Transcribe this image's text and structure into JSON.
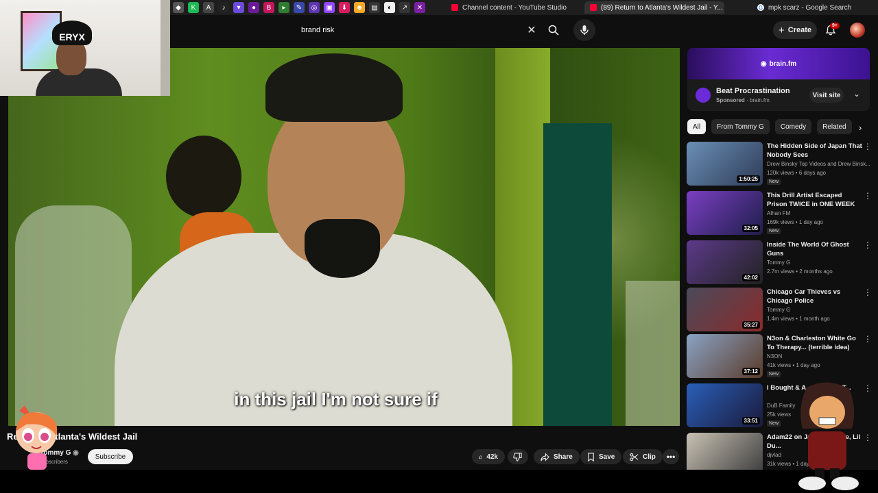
{
  "browser": {
    "tabs": [
      {
        "title": "Channel content - YouTube Studio",
        "active": false
      },
      {
        "title": "(89) Return to Atlanta's Wildest Jail - Y...",
        "active": true
      },
      {
        "title": "mpk scarz - Google Search",
        "active": false
      }
    ]
  },
  "header": {
    "search_value": "brand risk",
    "create_label": "Create",
    "notifications": "9+"
  },
  "video": {
    "caption": "in this jail I'm not sure if",
    "title": "Return to Atlanta's Wildest Jail",
    "title_visible": "Ret...nta's Wildest Jail",
    "channel": "Tommy G",
    "channel_visible": "my G",
    "subs_visible": "subscribers",
    "subscribe_label": "Subscribe",
    "likes": "42k",
    "share_label": "Share",
    "save_label": "Save",
    "clip_label": "Clip"
  },
  "ad": {
    "banner_text": "brain.fm",
    "title": "Beat Procrastination",
    "sponsored": "Sponsored",
    "domain": "brain.fm",
    "visit_label": "Visit site"
  },
  "chips": [
    "All",
    "From Tommy G",
    "Comedy",
    "Related"
  ],
  "recommendations": [
    {
      "title": "The Hidden Side of Japan That Nobody Sees",
      "channel": "Drew Binsky Top Videos and Drew Binsk...",
      "stats": "120k views • 6 days ago",
      "badge": "New",
      "duration": "1:50:25",
      "colors": [
        "#6a8fb5",
        "#2f3b58"
      ]
    },
    {
      "title": "This Drill Artist Escaped Prison TWICE in ONE WEEK",
      "channel": "Alhan FM",
      "stats": "169k views • 1 day ago",
      "badge": "New",
      "duration": "32:05",
      "colors": [
        "#7a3fc2",
        "#1e1e4a"
      ]
    },
    {
      "title": "Inside The World Of Ghost Guns",
      "channel": "Tommy G",
      "stats": "2.7m views • 2 months ago",
      "badge": "",
      "duration": "42:02",
      "colors": [
        "#5c3a8a",
        "#222"
      ]
    },
    {
      "title": "Chicago Car Thieves vs Chicago Police",
      "channel": "Tommy G",
      "stats": "1.4m views • 1 month ago",
      "badge": "",
      "duration": "35:27",
      "colors": [
        "#4a4a5a",
        "#8a2b2b"
      ]
    },
    {
      "title": "N3on & Charleston White Go To Therapy... (terrible idea)",
      "channel": "N3ON",
      "stats": "41k views • 1 day ago",
      "badge": "New",
      "duration": "37:12",
      "colors": [
        "#8aa3c4",
        "#5a3b2a"
      ]
    },
    {
      "title": "I Bought & A... Beans In T...",
      "channel": "DuB Family",
      "stats": "25k views",
      "badge": "New",
      "duration": "33:51",
      "colors": [
        "#2a5fb8",
        "#1a1a3a"
      ]
    },
    {
      "title": "Adam22 on Jas... Blueface, Lil Du...",
      "channel": "djvlad",
      "stats": "31k views • 1 day",
      "badge": "",
      "duration": "",
      "colors": [
        "#c9c2b4",
        "#3a3a3a"
      ]
    }
  ],
  "icons": {
    "search": "search-icon",
    "clear": "close-icon",
    "mic": "mic-icon",
    "bell": "bell-icon",
    "like": "thumbs-up-icon",
    "dislike": "thumbs-down-icon",
    "share": "share-icon",
    "save": "bookmark-icon",
    "clip": "scissors-icon",
    "more": "more-horizontal-icon"
  }
}
